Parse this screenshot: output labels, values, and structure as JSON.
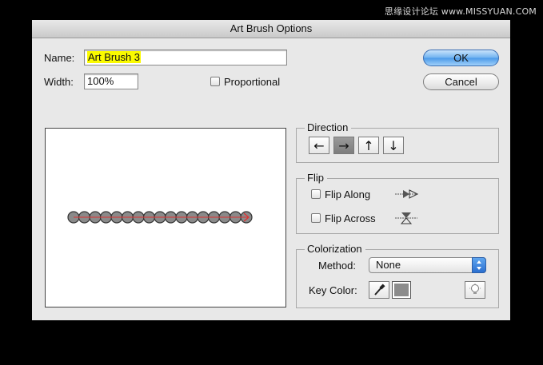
{
  "watermark": "思缘设计论坛 www.MISSYUAN.COM",
  "dialog": {
    "title": "Art Brush Options",
    "name_label": "Name:",
    "name_value": "Art Brush 3",
    "width_label": "Width:",
    "width_value": "100%",
    "proportional_label": "Proportional",
    "proportional_checked": false,
    "ok_label": "OK",
    "cancel_label": "Cancel"
  },
  "direction": {
    "title": "Direction",
    "buttons": [
      {
        "icon": "arrow-left-icon",
        "glyph": "←",
        "active": false
      },
      {
        "icon": "arrow-right-icon",
        "glyph": "→",
        "active": true
      },
      {
        "icon": "arrow-up-icon",
        "glyph": "↑",
        "active": false
      },
      {
        "icon": "arrow-down-icon",
        "glyph": "↓",
        "active": false
      }
    ]
  },
  "flip": {
    "title": "Flip",
    "along_label": "Flip Along",
    "along_checked": false,
    "across_label": "Flip Across",
    "across_checked": false
  },
  "colorization": {
    "title": "Colorization",
    "method_label": "Method:",
    "method_value": "None",
    "key_color_label": "Key Color:",
    "key_color_swatch": "#8c8c8c"
  },
  "preview": {
    "bead_count": 17,
    "bead_color": "#8a8a8a",
    "arrow_color": "#e03030"
  }
}
